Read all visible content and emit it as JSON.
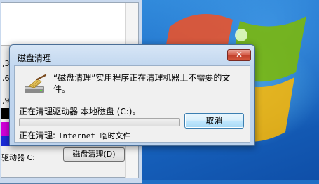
{
  "background_window": {
    "fragments": [
      ",3",
      ",6",
      ",9"
    ],
    "drive_label": "驱动器 C:",
    "disk_cleanup_button": "磁盘清理(D)"
  },
  "dialog": {
    "title": "磁盘清理",
    "close_glyph": "✕",
    "message": "“磁盘清理”实用程序正在清理机器上不需要的文件。",
    "cleaning_drive_label": "正在清理驱动器",
    "cleaning_drive_value": "本地磁盘 (C:)。",
    "progress": 0,
    "cancel_label": "取消",
    "cleaning_file_label": "正在清理:",
    "cleaning_file_value": "Internet 临时文件"
  },
  "colors": {
    "desktop": "#1f6fc6",
    "close_button": "#c1402c",
    "dialog_frame": "#c2d7ef",
    "cancel_button": "#bee6fd"
  },
  "icons": [
    "windows-logo-icon",
    "disk-cleanup-broom-icon",
    "close-icon"
  ]
}
